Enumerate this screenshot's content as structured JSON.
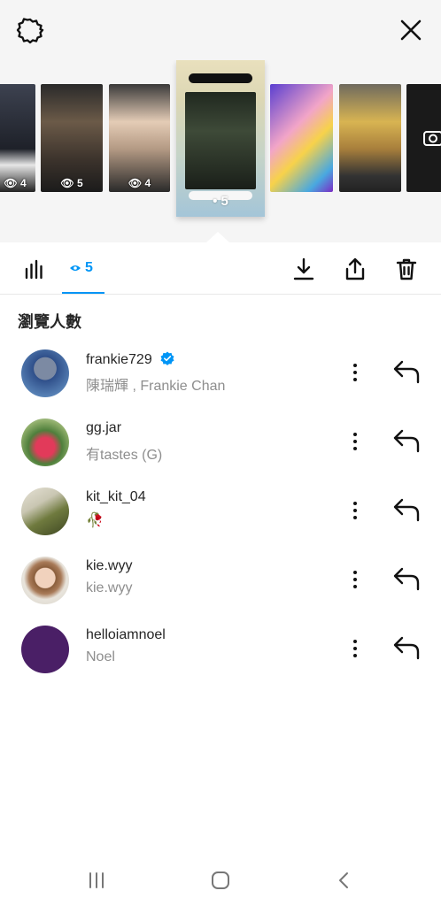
{
  "header": {
    "settings_icon": "gear-icon",
    "close_icon": "close-icon"
  },
  "strip": {
    "thumbs": [
      {
        "views": "4"
      },
      {
        "views": "5"
      },
      {
        "views": "4"
      },
      {
        "views": ""
      },
      {
        "views": ""
      },
      {
        "views": ""
      }
    ],
    "selected_views": "5"
  },
  "actionbar": {
    "viewers_count": "5",
    "icons": [
      "bar-chart-icon",
      "eye-icon",
      "download-icon",
      "share-icon",
      "trash-icon"
    ]
  },
  "viewers_heading": "瀏覽人數",
  "viewers": [
    {
      "username": "frankie729",
      "fullname": "陳瑞輝 , Frankie Chan",
      "verified": true
    },
    {
      "username": "gg.jar",
      "fullname": "有tastes (G)",
      "verified": false
    },
    {
      "username": "kit_kit_04",
      "fullname": "🥀",
      "verified": false
    },
    {
      "username": "kie.wyy",
      "fullname": "kie.wyy",
      "verified": false
    },
    {
      "username": "helloiamnoel",
      "fullname": "Noel",
      "verified": false
    }
  ],
  "colors": {
    "accent": "#0095f6",
    "last_avatar": "#4a1f66"
  },
  "navbar": {
    "icons": [
      "recents-icon",
      "home-icon",
      "back-icon"
    ]
  }
}
